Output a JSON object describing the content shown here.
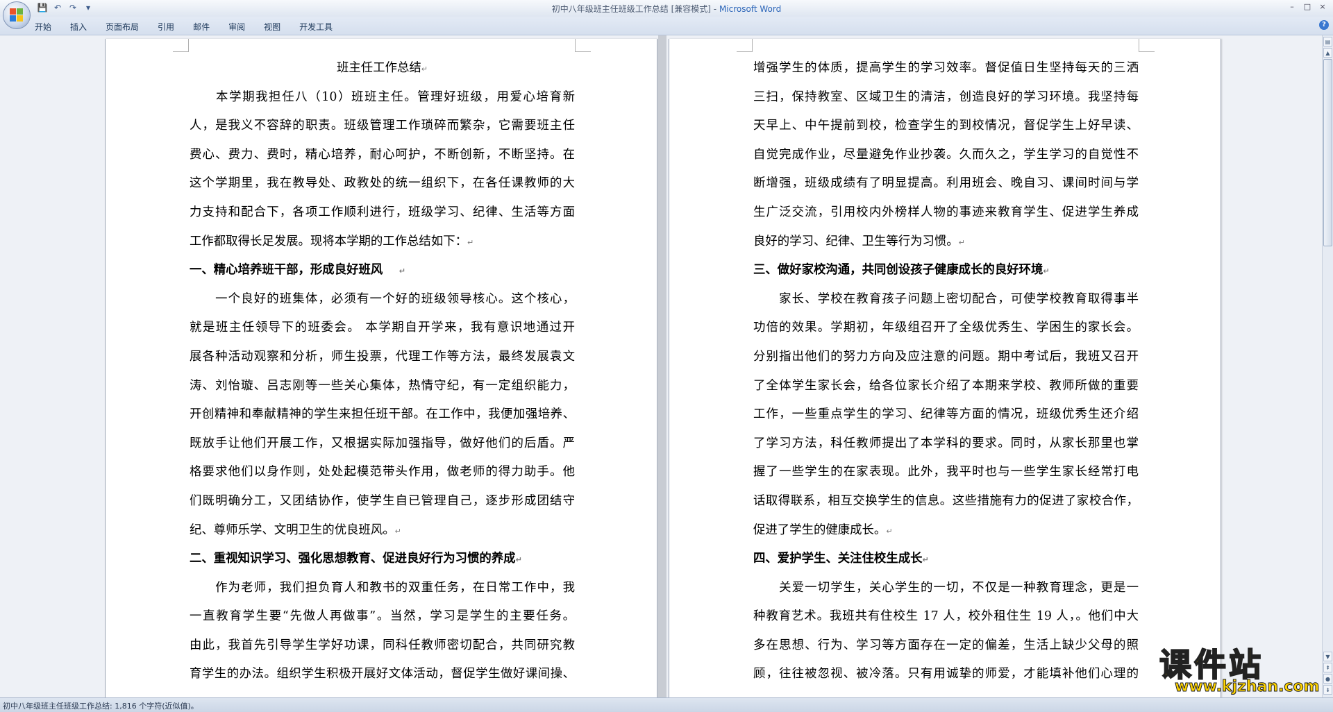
{
  "window": {
    "title_doc": "初中八年级班主任班级工作总结 [兼容模式]",
    "title_sep": " - ",
    "title_app": "Microsoft Word",
    "controls": [
      "–",
      "□",
      "×"
    ]
  },
  "qat": {
    "save": "💾",
    "undo": "↶",
    "redo": "↷",
    "more": "▾"
  },
  "ribbon": {
    "tabs": [
      "开始",
      "插入",
      "页面布局",
      "引用",
      "邮件",
      "审阅",
      "视图",
      "开发工具"
    ],
    "help": "?"
  },
  "page1": {
    "lines": [
      {
        "text": "班主任工作总结",
        "mark": "↵",
        "style": "title"
      },
      {
        "text": "　　本学期我担任八（10）班班主任。管理好班级，用爱心培育新",
        "style": "body"
      },
      {
        "text": "人，是我义不容辞的职责。班级管理工作琐碎而繁杂，它需要班主任",
        "style": "body"
      },
      {
        "text": "费心、费力、费时，精心培养，耐心呵护，不断创新，不断坚持。在",
        "style": "body"
      },
      {
        "text": "这个学期里，我在教导处、政教处的统一组织下，在各任课教师的大",
        "style": "body"
      },
      {
        "text": "力支持和配合下，各项工作顺利进行，班级学习、纪律、生活等方面",
        "style": "body"
      },
      {
        "text": "工作都取得长足发展。现将本学期的工作总结如下：",
        "mark": "↵",
        "style": "last"
      },
      {
        "text": "一、精心培养班干部，形成良好班风　 ",
        "mark": "↵",
        "style": "head"
      },
      {
        "text": "　　一个良好的班集体，必须有一个好的班级领导核心。这个核心，",
        "style": "body"
      },
      {
        "text": "就是班主任领导下的班委会。 本学期自开学来，我有意识地通过开",
        "style": "body"
      },
      {
        "text": "展各种活动观察和分析，师生投票，代理工作等方法，最终发展袁文",
        "style": "body"
      },
      {
        "text": "涛、刘怡璇、吕志刚等一些关心集体，热情守纪，有一定组织能力，",
        "style": "body"
      },
      {
        "text": "开创精神和奉献精神的学生来担任班干部。在工作中，我便加强培养、",
        "style": "body"
      },
      {
        "text": "既放手让他们开展工作，又根据实际加强指导，做好他们的后盾。严",
        "style": "body"
      },
      {
        "text": "格要求他们以身作则，处处起模范带头作用，做老师的得力助手。他",
        "style": "body"
      },
      {
        "text": "们既明确分工，又团结协作，使学生自已管理自己，逐步形成团结守",
        "style": "body"
      },
      {
        "text": "纪、尊师乐学、文明卫生的优良班风。",
        "mark": "↵",
        "style": "last"
      },
      {
        "text": "二、重视知识学习、强化思想教育、促进良好行为习惯的养成",
        "mark": "↵",
        "style": "head"
      },
      {
        "text": "　　作为老师，我们担负育人和教书的双重任务，在日常工作中，我",
        "style": "body"
      },
      {
        "text": "一直教育学生要“先做人再做事”。当然，学习是学生的主要任务。",
        "style": "body"
      },
      {
        "text": "由此，我首先引导学生学好功课，同科任教师密切配合，共同研究教",
        "style": "body"
      },
      {
        "text": "育学生的办法。组织学生积极开展好文体活动，督促学生做好课间操、",
        "style": "body"
      }
    ]
  },
  "page2": {
    "lines": [
      {
        "text": "增强学生的体质，提高学生的学习效率。督促值日生坚持每天的三洒",
        "style": "body"
      },
      {
        "text": "三扫，保持教室、区域卫生的清洁，创造良好的学习环境。我坚持每",
        "style": "body"
      },
      {
        "text": "天早上、中午提前到校，检查学生的到校情况，督促学生上好早读、",
        "style": "body"
      },
      {
        "text": "自觉完成作业，尽量避免作业抄袭。久而久之，学生学习的自觉性不",
        "style": "body"
      },
      {
        "text": "断增强，班级成绩有了明显提高。利用班会、晚自习、课间时间与学",
        "style": "body"
      },
      {
        "text": "生广泛交流，引用校内外榜样人物的事迹来教育学生、促进学生养成",
        "style": "body"
      },
      {
        "text": "良好的学习、纪律、卫生等行为习惯。",
        "mark": "↵",
        "style": "last"
      },
      {
        "text": "三、做好家校沟通，共同创设孩子健康成长的良好环境",
        "mark": "↵",
        "style": "head"
      },
      {
        "text": "　　家长、学校在教育孩子问题上密切配合，可使学校教育取得事半",
        "style": "body"
      },
      {
        "text": "功倍的效果。学期初，年级组召开了全级优秀生、学困生的家长会。",
        "style": "body"
      },
      {
        "text": "分别指出他们的努力方向及应注意的问题。期中考试后，我班又召开",
        "style": "body"
      },
      {
        "text": "了全体学生家长会，给各位家长介绍了本期来学校、教师所做的重要",
        "style": "body"
      },
      {
        "text": "工作，一些重点学生的学习、纪律等方面的情况，班级优秀生还介绍",
        "style": "body"
      },
      {
        "text": "了学习方法，科任教师提出了本学科的要求。同时，从家长那里也掌",
        "style": "body"
      },
      {
        "text": "握了一些学生的在家表现。此外，我平时也与一些学生家长经常打电",
        "style": "body"
      },
      {
        "text": "话取得联系，相互交换学生的信息。这些措施有力的促进了家校合作，",
        "style": "body"
      },
      {
        "text": "促进了学生的健康成长。",
        "mark": "↵",
        "style": "last"
      },
      {
        "text": "四、爱护学生、关注住校生成长",
        "mark": "↵",
        "style": "head"
      },
      {
        "text": "　　关爱一切学生，关心学生的一切，不仅是一种教育理念，更是一",
        "style": "body"
      },
      {
        "text": "种教育艺术。我班共有住校生 17 人，校外租住生 19 人，。他们中大",
        "style": "body"
      },
      {
        "text": "多在思想、行为、学习等方面存在一定的偏差，生活上缺少父母的照",
        "style": "body"
      },
      {
        "text": "顾，往往被忽视、被冷落。只有用诚挚的师爱，才能填补他们心理的",
        "style": "body"
      }
    ]
  },
  "statusbar": {
    "text": "初中八年级班主任班级工作总结: 1,816 个字符(近似值)。"
  },
  "watermark": {
    "cn": "课件站",
    "url": "www.kjzhan.com"
  }
}
